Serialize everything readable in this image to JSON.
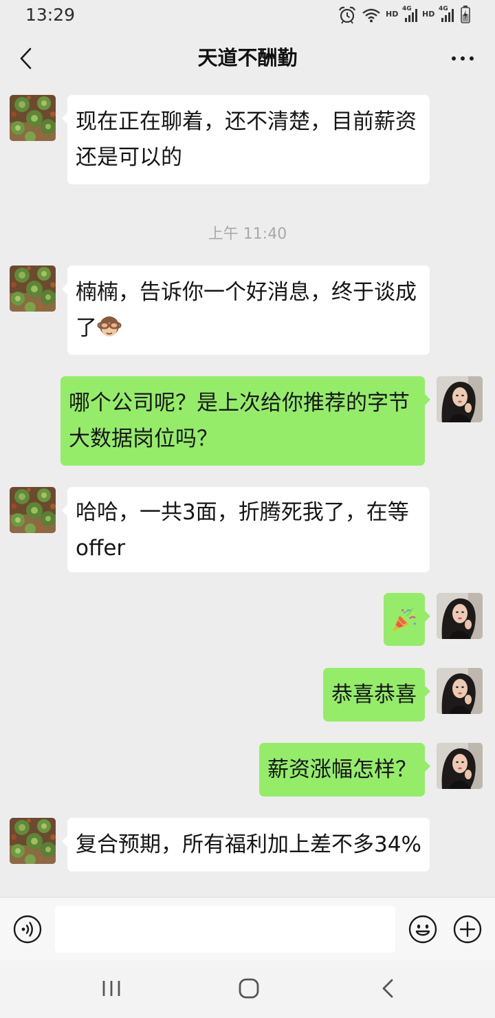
{
  "status_bar": {
    "time": "13:29",
    "sim1_hd": "HD",
    "sim1_net": "4G",
    "sim2_hd": "HD",
    "sim2_net": "4G",
    "icons": [
      "alarm-icon",
      "wifi-icon",
      "signal-icon",
      "signal-icon",
      "battery-charging-icon"
    ]
  },
  "header": {
    "title": "天道不酬勤",
    "back_icon": "chevron-left-icon",
    "more_icon": "more-dots-icon"
  },
  "messages": [
    {
      "outgoing": false,
      "text": "现在正在聊着，还不清楚，目前薪资还是可以的"
    },
    {
      "timestamp": "上午 11:40"
    },
    {
      "outgoing": false,
      "text": "楠楠，告诉你一个好消息，终于谈成了",
      "emoji": "see-no-evil-monkey-icon"
    },
    {
      "outgoing": true,
      "text": "哪个公司呢？是上次给你推荐的字节大数据岗位吗？"
    },
    {
      "outgoing": false,
      "text": "哈哈，一共3面，折腾死我了，在等offer"
    },
    {
      "outgoing": true,
      "emoji": "party-popper-icon"
    },
    {
      "outgoing": true,
      "text": "恭喜恭喜"
    },
    {
      "outgoing": true,
      "text": "薪资涨幅怎样？"
    },
    {
      "outgoing": false,
      "text": "复合预期，所有福利加上差不多34%"
    }
  ],
  "input_bar": {
    "value": "",
    "icons": {
      "voice": "voice-icon",
      "emoji": "emoji-face-icon",
      "more": "plus-icon"
    }
  },
  "nav_bar": {
    "icons": [
      "recent-apps-icon",
      "home-icon",
      "back-icon"
    ]
  },
  "colors": {
    "background": "#EDEDED",
    "my_bubble": "#95EC69",
    "contact_bubble": "#FFFFFF",
    "timestamp": "#A9A9A9"
  }
}
